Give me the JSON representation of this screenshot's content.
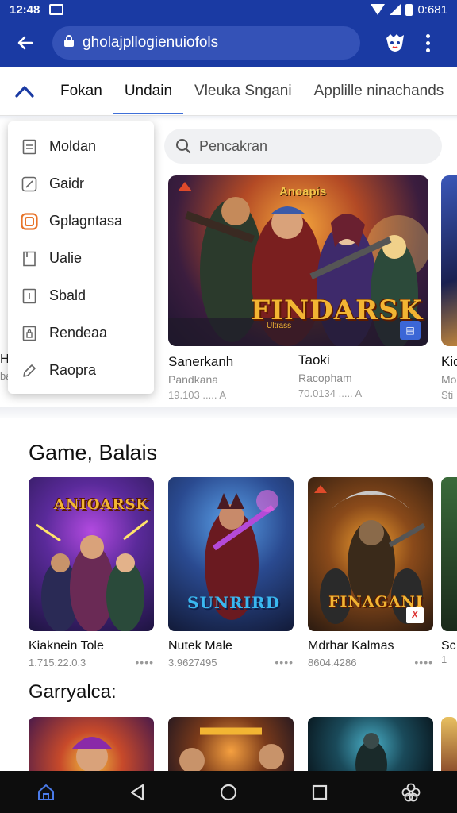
{
  "status_bar": {
    "time": "12:48",
    "right_text": "0:681"
  },
  "url_bar": {
    "url": "gholajpllogienuiofols"
  },
  "tabs": [
    {
      "label": "Fokan"
    },
    {
      "label": "Undain",
      "active": true
    },
    {
      "label": "Vleuka Sngani"
    },
    {
      "label": "Applille ninachands"
    }
  ],
  "search": {
    "placeholder": "Pencakran"
  },
  "menu": {
    "items": [
      {
        "label": "Moldan",
        "icon": "document-icon"
      },
      {
        "label": "Gaidr",
        "icon": "edit-box-icon"
      },
      {
        "label": "Gplagntasa",
        "icon": "app-grid-icon",
        "accent": "#e8742a"
      },
      {
        "label": "Ualie",
        "icon": "bookmark-icon"
      },
      {
        "label": "Sbald",
        "icon": "file-icon"
      },
      {
        "label": "Rendeaa",
        "icon": "locked-file-icon"
      },
      {
        "label": "Raopra",
        "icon": "pencil-icon"
      }
    ]
  },
  "featured": [
    {
      "title": "Sanerkanh",
      "subtitle": "Pandkana",
      "meta": "19.103 ..... A",
      "art_logo": "FINDARSK",
      "art_badge": "Ultrass",
      "banner_tag": "Anoapis"
    },
    {
      "title": "Taoki",
      "subtitle": "Racopham",
      "meta": "70.0134 ..... A"
    },
    {
      "title": "Kid",
      "subtitle": "Mo",
      "meta": "Sti"
    }
  ],
  "peek_left": {
    "title": "H",
    "subtitle": "ba"
  },
  "sections": [
    {
      "title": "Game, Balais",
      "items": [
        {
          "name": "Kiaknein Tole",
          "size": "1.715.22.0.3",
          "art_logo": "ANIOARSK"
        },
        {
          "name": "Nutek Male",
          "size": "3.9627495",
          "art_logo": "SUNRIRD"
        },
        {
          "name": "Mdrhar Kalmas",
          "size": "8604.4286",
          "art_logo": "FINAGANI"
        },
        {
          "name": "Sc",
          "size": "1"
        }
      ]
    },
    {
      "title": "Garryalca:"
    }
  ],
  "colors": {
    "brand_blue": "#1a3aa3",
    "url_field": "#3452b7",
    "tab_indicator": "#3f6fd8",
    "menu_accent": "#e8742a"
  }
}
